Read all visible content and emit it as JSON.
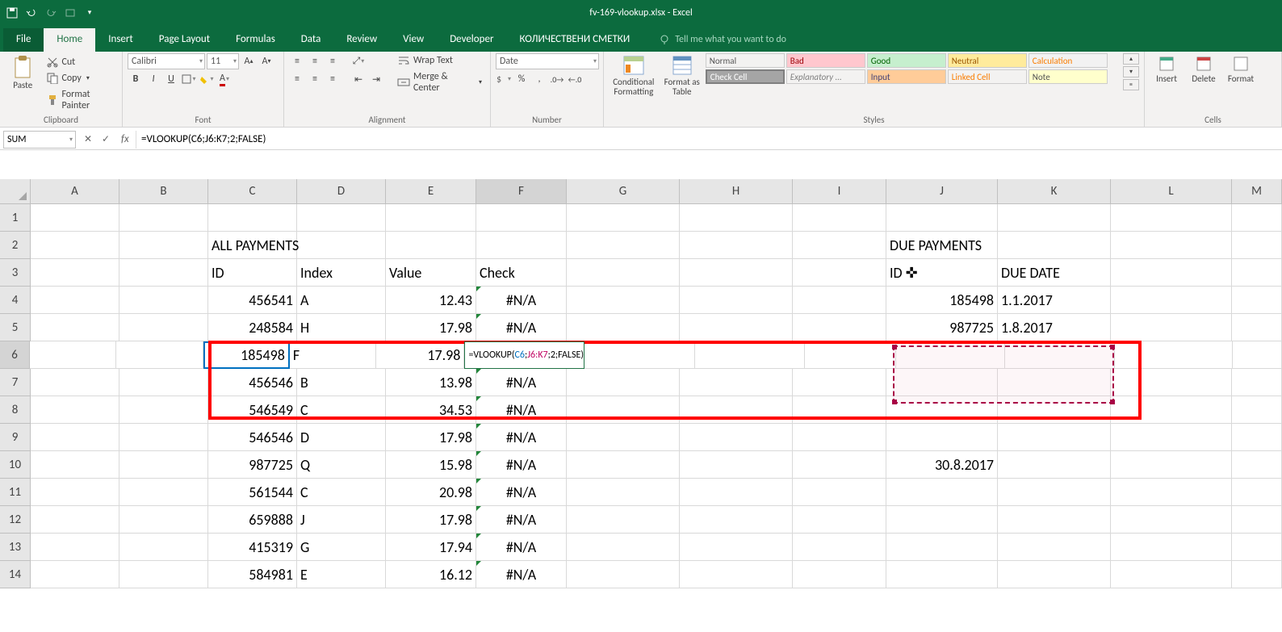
{
  "title": "fv-169-vlookup.xlsx - Excel",
  "tabs": [
    "File",
    "Home",
    "Insert",
    "Page Layout",
    "Formulas",
    "Data",
    "Review",
    "View",
    "Developer",
    "КОЛИЧЕСТВЕНИ СМЕТКИ"
  ],
  "active_tab": 1,
  "tell_me": "Tell me what you want to do",
  "clipboard": {
    "cut": "Cut",
    "copy": "Copy",
    "fp": "Format Painter",
    "label": "Clipboard"
  },
  "font": {
    "name": "Calibri",
    "size": "11",
    "label": "Font"
  },
  "alignment": {
    "wrap": "Wrap Text",
    "merge": "Merge & Center",
    "label": "Alignment"
  },
  "number": {
    "format": "Date",
    "label": "Number"
  },
  "cond": {
    "cf": "Conditional Formatting",
    "fat": "Format as Table",
    "label": "Styles"
  },
  "styles": {
    "normal": "Normal",
    "bad": "Bad",
    "good": "Good",
    "neutral": "Neutral",
    "calc": "Calculation",
    "check": "Check Cell",
    "expl": "Explanatory ...",
    "input": "Input",
    "link": "Linked Cell",
    "note": "Note"
  },
  "cells_grp": {
    "insert": "Insert",
    "delete": "Delete",
    "format": "Format",
    "label": "Cells"
  },
  "name_box": "SUM",
  "formula_bar": "=VLOOKUP(C6;J6:K7;2;FALSE)",
  "cols": [
    "A",
    "B",
    "C",
    "D",
    "E",
    "F",
    "G",
    "H",
    "I",
    "J",
    "K",
    "L",
    "M"
  ],
  "active_col": "F",
  "active_row": 6,
  "head1": {
    "all": "ALL PAYMENTS",
    "due": "DUE PAYMENTS"
  },
  "head2": {
    "id": "ID",
    "index": "Index",
    "value": "Value",
    "check": "Check",
    "id2": "ID ✜",
    "duedate": "DUE DATE"
  },
  "rows": [
    {
      "n": 1
    },
    {
      "n": 2
    },
    {
      "n": 3
    },
    {
      "n": 4,
      "C": "456541",
      "D": "A",
      "E": "12.43",
      "F": "#N/A",
      "J": "185498",
      "K": "1.1.2017"
    },
    {
      "n": 5,
      "C": "248584",
      "D": "H",
      "E": "17.98",
      "F": "#N/A",
      "J": "987725",
      "K": "1.8.2017"
    },
    {
      "n": 6,
      "C": "185498",
      "D": "F",
      "E": "17.98"
    },
    {
      "n": 7,
      "C": "456546",
      "D": "B",
      "E": "13.98",
      "F": "#N/A"
    },
    {
      "n": 8,
      "C": "546549",
      "D": "C",
      "E": "34.53",
      "F": "#N/A"
    },
    {
      "n": 9,
      "C": "546546",
      "D": "D",
      "E": "17.98",
      "F": "#N/A"
    },
    {
      "n": 10,
      "C": "987725",
      "D": "Q",
      "E": "15.98",
      "F": "#N/A",
      "J": "30.8.2017"
    },
    {
      "n": 11,
      "C": "561544",
      "D": "C",
      "E": "20.98",
      "F": "#N/A"
    },
    {
      "n": 12,
      "C": "659888",
      "D": "J",
      "E": "17.98",
      "F": "#N/A"
    },
    {
      "n": 13,
      "C": "415319",
      "D": "G",
      "E": "17.94",
      "F": "#N/A"
    },
    {
      "n": 14,
      "C": "584981",
      "D": "E",
      "E": "16.12",
      "F": "#N/A"
    }
  ],
  "edit_formula": {
    "pre": "=VLOOKUP(",
    "c6": "C6",
    "mid": ";",
    "range": "J6:K7",
    "post": ";2;FALSE)"
  }
}
